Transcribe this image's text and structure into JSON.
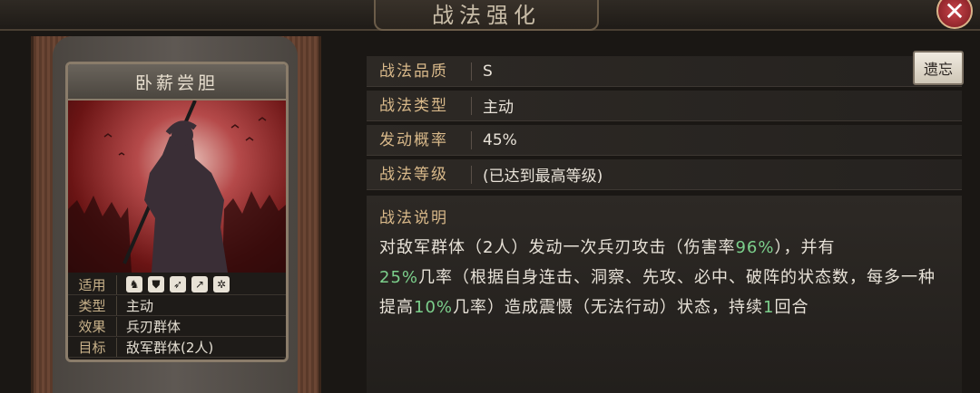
{
  "header": {
    "title": "战法强化",
    "close_label": "✕"
  },
  "card": {
    "name": "卧薪尝胆",
    "rows": [
      {
        "key": "适用",
        "icons": [
          "horse-icon",
          "shield-icon",
          "bow-icon",
          "spear-icon",
          "wheel-icon"
        ]
      },
      {
        "key": "类型",
        "value": "主动"
      },
      {
        "key": "效果",
        "value": "兵刃群体"
      },
      {
        "key": "目标",
        "value": "敌军群体(2人)"
      }
    ]
  },
  "info": {
    "quality_label": "战法品质",
    "quality_value": "S",
    "type_label": "战法类型",
    "type_value": "主动",
    "chance_label": "发动概率",
    "chance_value": "45%",
    "level_label": "战法等级",
    "level_value": "(已达到最高等级)",
    "forget_button": "遗忘"
  },
  "description": {
    "title": "战法说明",
    "p1": "对敌军群体（2人）发动一次兵刃攻击（伤害率",
    "hl1": "96%",
    "p2": "），并有",
    "hl2": "25%",
    "p3": "几率（根据自身连击、洞察、先攻、必中、破阵的状态数，每多一种提高",
    "hl3": "10%",
    "p4": "几率）造成震慑（无法行动）状态，持续",
    "hl4": "1",
    "p5": "回合"
  },
  "colors": {
    "label_gold": "#d9b98a",
    "highlight_green": "#7cd08c"
  }
}
